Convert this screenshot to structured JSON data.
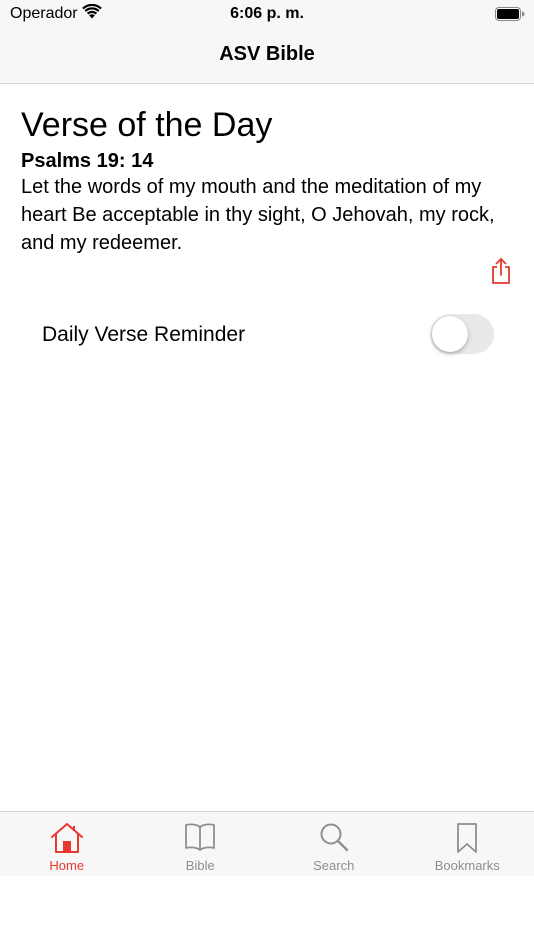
{
  "status_bar": {
    "carrier": "Operador",
    "time": "6:06 p. m."
  },
  "nav": {
    "title": "ASV Bible"
  },
  "verse_of_day": {
    "heading": "Verse of the Day",
    "reference": "Psalms 19: 14",
    "text": "Let the words of my mouth and the meditation of my heart Be acceptable in thy sight, O Jehovah, my rock, and my redeemer."
  },
  "reminder": {
    "label": "Daily Verse Reminder",
    "enabled": false
  },
  "tabs": [
    {
      "label": "Home",
      "icon": "home-icon",
      "active": true
    },
    {
      "label": "Bible",
      "icon": "book-icon",
      "active": false
    },
    {
      "label": "Search",
      "icon": "search-icon",
      "active": false
    },
    {
      "label": "Bookmarks",
      "icon": "bookmark-icon",
      "active": false
    }
  ],
  "colors": {
    "accent": "#e8382f",
    "inactive": "#8e8e93",
    "toggle_off": "#e9e9eb"
  }
}
